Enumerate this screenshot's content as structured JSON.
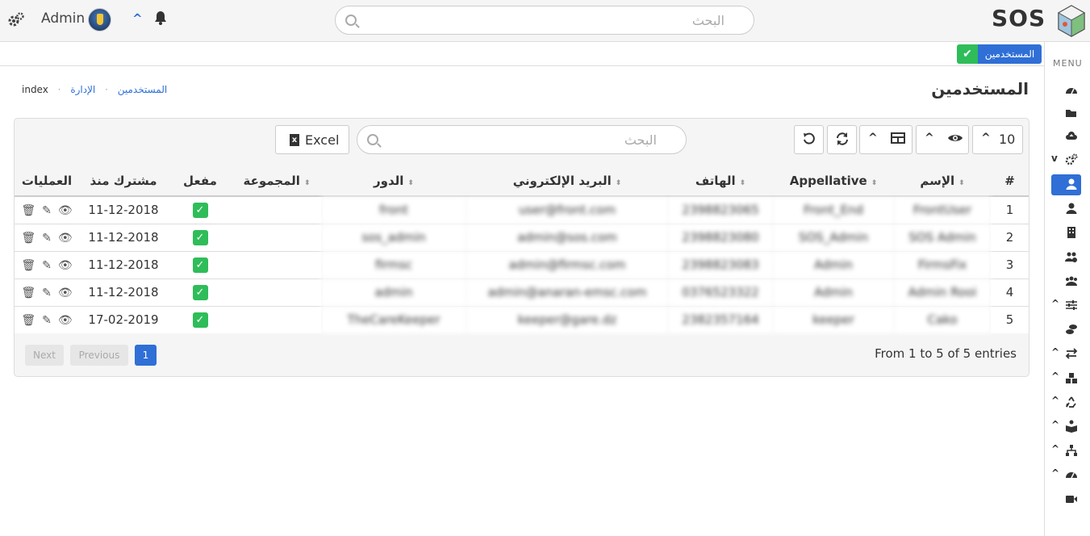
{
  "topbar": {
    "user_name": "Admin",
    "search_placeholder": "البحث",
    "brand": "SOS"
  },
  "subbar": {
    "tag_label": "المستخدمين"
  },
  "page": {
    "title": "المستخدمين"
  },
  "breadcrumb": {
    "items": [
      "الإدارة",
      "المستخدمين",
      "index"
    ]
  },
  "nav": {
    "menu_label": "MENU"
  },
  "toolbar": {
    "excel_label": "Excel",
    "search_placeholder": "البحث",
    "page_size": "10"
  },
  "table": {
    "headers": {
      "index": "#",
      "name": "الإسم",
      "appellative": "Appellative",
      "phone": "الهاتف",
      "email": "البريد الإلكتروني",
      "role": "الدور",
      "group": "المجموعة",
      "active": "مفعل",
      "since": "مشترك منذ",
      "ops": "العمليات"
    },
    "rows": [
      {
        "index": "1",
        "name": "FrontUser",
        "appellative": "Front_End",
        "phone": "2398823065",
        "email": "user@front.com",
        "role": "front",
        "since": "11-12-2018"
      },
      {
        "index": "2",
        "name": "SOS Admin",
        "appellative": "SOS_Admin",
        "phone": "2398823080",
        "email": "admin@sos.com",
        "role": "sos_admin",
        "since": "11-12-2018"
      },
      {
        "index": "3",
        "name": "FirmsFix",
        "appellative": "Admin",
        "phone": "2398823083",
        "email": "admin@firmsc.com",
        "role": "firmsc",
        "since": "11-12-2018"
      },
      {
        "index": "4",
        "name": "Admin Rooi",
        "appellative": "Admin",
        "phone": "0376523322",
        "email": "admin@anaran-emsc.com",
        "role": "admin",
        "since": "11-12-2018"
      },
      {
        "index": "5",
        "name": "Cako",
        "appellative": "keeper",
        "phone": "2382357164",
        "email": "keeper@gare.dz",
        "role": "TheCareKeeper",
        "since": "17-02-2019"
      }
    ]
  },
  "pager": {
    "next": "Next",
    "previous": "Previous",
    "current": "1",
    "entries": "From 1 to 5 of 5 entries"
  },
  "colors": {
    "accent": "#2f6fd6",
    "success": "#2ebd59"
  }
}
